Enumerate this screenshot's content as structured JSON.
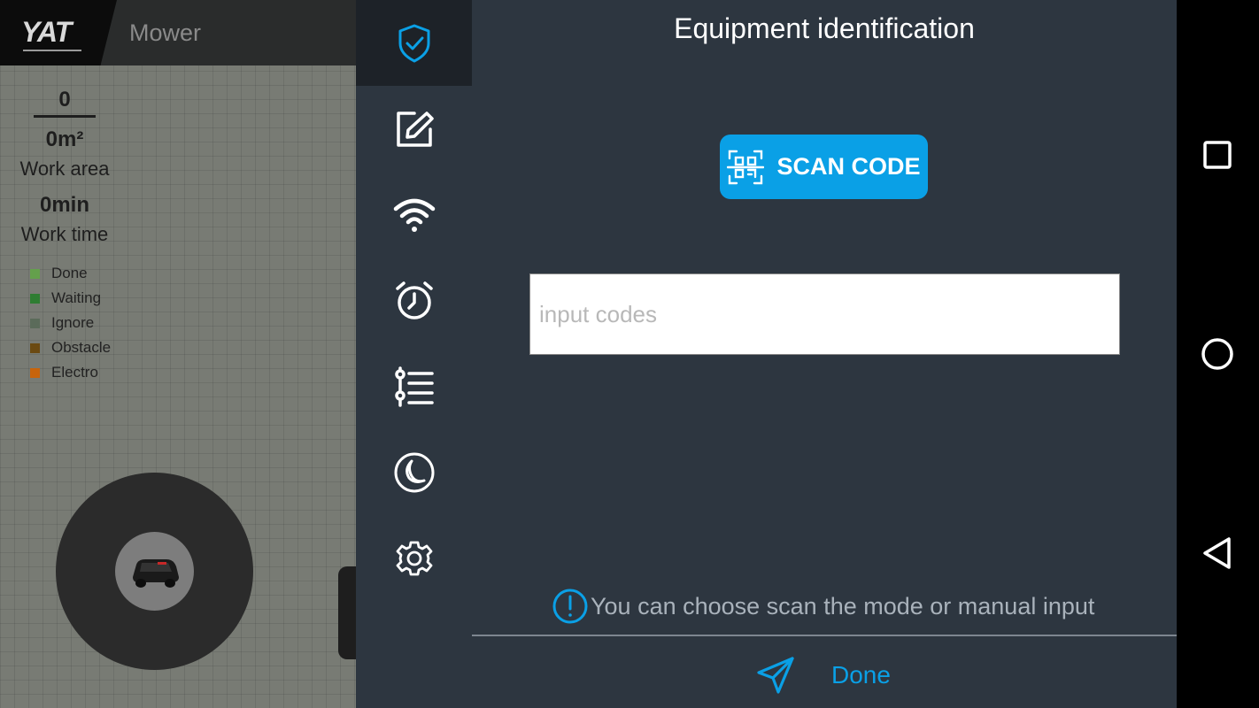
{
  "header": {
    "logo_text": "YAT",
    "title": "Mower"
  },
  "stats": {
    "count": "0",
    "area": "0m²",
    "area_label": "Work area",
    "time": "0min",
    "time_label": "Work time"
  },
  "legend": [
    {
      "label": "Done",
      "color": "#64a04c"
    },
    {
      "label": "Waiting",
      "color": "#2e7d32"
    },
    {
      "label": "Ignore",
      "color": "#5b6b5a"
    },
    {
      "label": "Obstacle",
      "color": "#6b4a12"
    },
    {
      "label": "Electro",
      "color": "#c7640c"
    }
  ],
  "sidebar": {
    "items": [
      {
        "icon": "shield-check-icon",
        "active": true
      },
      {
        "icon": "edit-icon",
        "active": false
      },
      {
        "icon": "wifi-icon",
        "active": false
      },
      {
        "icon": "alarm-clock-icon",
        "active": false
      },
      {
        "icon": "list-settings-icon",
        "active": false
      },
      {
        "icon": "moon-icon",
        "active": false
      },
      {
        "icon": "gear-icon",
        "active": false
      }
    ]
  },
  "main": {
    "title": "Equipment identification",
    "scan_label": "SCAN CODE",
    "input_placeholder": "input codes",
    "input_value": "",
    "hint": "You can choose scan the mode or manual input",
    "done_label": "Done"
  },
  "colors": {
    "accent": "#0aa0e6",
    "panel": "#2d3640",
    "active_sidebar": "#1d2228"
  }
}
